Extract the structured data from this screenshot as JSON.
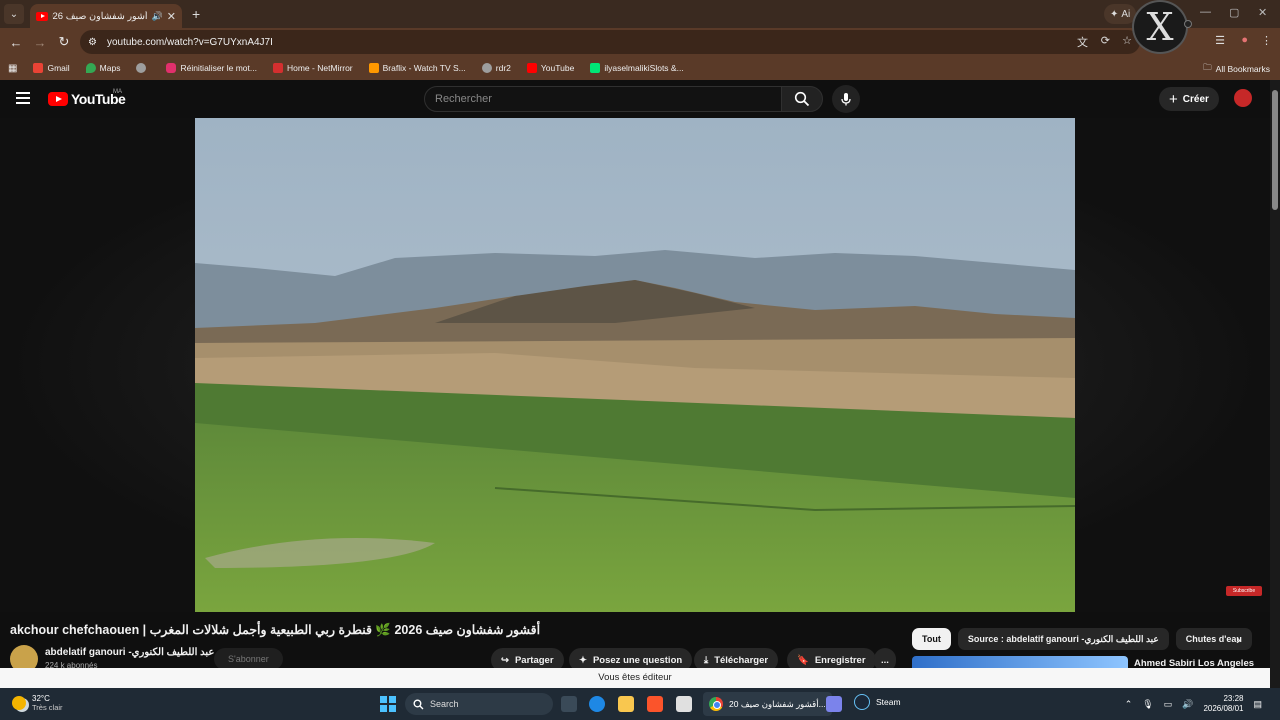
{
  "browser": {
    "tab_title": "أشور شفشاون صيف 2026 🌿 قنطرة ربي",
    "new_tab": "+",
    "ai_chip_label": "Ai",
    "url": "youtube.com/watch?v=G7UYxnA4J7I",
    "bookmarks": [
      {
        "label": "Gmail",
        "color": "#ea4335"
      },
      {
        "label": "Maps",
        "color": "#34a853"
      },
      {
        "label": "",
        "color": "#9e9e9e"
      },
      {
        "label": "Réinitialiser le mot...",
        "color": "#e1306c"
      },
      {
        "label": "Home - NetMirror",
        "color": "#d32f2f"
      },
      {
        "label": "Braflix - Watch TV S...",
        "color": "#ff9800"
      },
      {
        "label": "rdr2",
        "color": "#9e9e9e"
      },
      {
        "label": "YouTube",
        "color": "#ff0000"
      },
      {
        "label": "ilyaselmalikiSlots &...",
        "color": "#00e676"
      }
    ],
    "all_bookmarks": "All Bookmarks"
  },
  "youtube": {
    "logo_text": "YouTube",
    "country": "MA",
    "search_placeholder": "Rechercher",
    "create_label": "Créer",
    "video": {
      "title": "akchour chefchaouen | أقشور شفشاون صيف 2026 🌿 قنطرة ربي الطبيعية وأجمل شلالات المغرب",
      "subscribe_badge": "Subscribe"
    },
    "channel": {
      "name": "abdelatif ganouri -عبد اللطيف الكنوري",
      "subscribers": "224 k abonnés",
      "subscribe_label": "S'abonner"
    },
    "actions": {
      "share": "Partager",
      "ask": "Posez une question",
      "download": "Télécharger",
      "save": "Enregistrer",
      "more": "..."
    },
    "chips": [
      "Tout",
      "Source : abdelatif ganouri -عبد اللطيف الكنوري",
      "Chutes d'eau"
    ],
    "recommended_title": "Ahmed Sabiri Los Angeles",
    "toast": "Vous êtes éditeur"
  },
  "taskbar": {
    "temp": "32°C",
    "weather": "Très clair",
    "search": "Search",
    "chrome_task": "أقشور شفشاون صيف 20...",
    "steam": "Steam",
    "time": "23:28",
    "date": "2026/08/01"
  }
}
